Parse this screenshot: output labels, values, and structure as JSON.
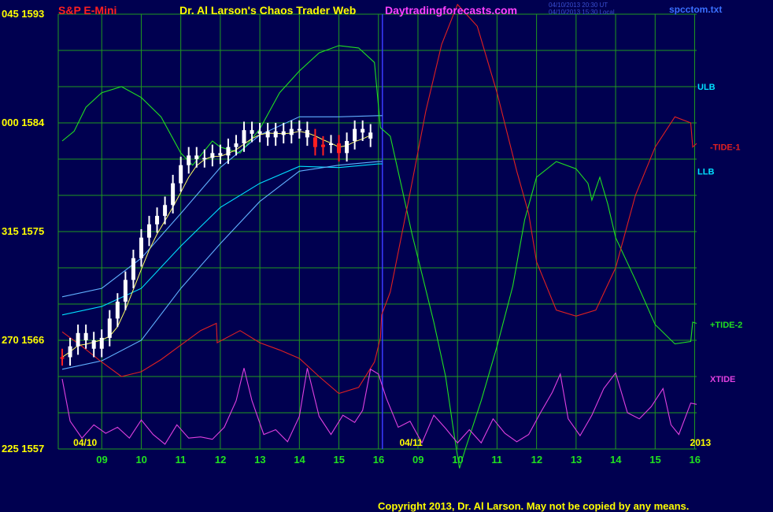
{
  "header": {
    "left_label": "S&P E-Mini",
    "title": "Dr. Al Larson's Chaos Trader Web",
    "site": "Daytradingforecasts.com",
    "file": "spcctom.txt",
    "timestamp_1": "04/10/2013 20:30 UT",
    "timestamp_2": "04/10/2013 15:30 Local"
  },
  "copyright": "Copyright 2013, Dr. Al Larson. May not be copied by any means.",
  "colors": {
    "background": "#000050",
    "grid": "#1f9a1f",
    "divider": "#3a3aff",
    "price_up": "#ffffff",
    "price_low": "#ffffaa",
    "price_down": "#ff2020",
    "ulb": "#00e0ff",
    "llb": "#00e0ff",
    "tide1": "#e02020",
    "tide2": "#20e020",
    "xtide": "#e040e0",
    "band": "#60b0ff",
    "ma": "#ffff60"
  },
  "chart_data": {
    "type": "line",
    "y_left_labels": [
      {
        "value": 1593,
        "text": "1593",
        "code": "045"
      },
      {
        "value": 1584,
        "text": "1584",
        "code": "000"
      },
      {
        "value": 1575,
        "text": "1575",
        "code": "315"
      },
      {
        "value": 1566,
        "text": "1566",
        "code": "270"
      },
      {
        "value": 1557,
        "text": "1557",
        "code": "225"
      }
    ],
    "ylim": [
      1557,
      1593
    ],
    "x_hour_labels": [
      {
        "t": 9,
        "text": "09"
      },
      {
        "t": 10,
        "text": "10"
      },
      {
        "t": 11,
        "text": "11"
      },
      {
        "t": 12,
        "text": "12"
      },
      {
        "t": 13,
        "text": "13"
      },
      {
        "t": 14,
        "text": "14"
      },
      {
        "t": 15,
        "text": "15"
      },
      {
        "t": 16,
        "text": "16"
      },
      {
        "t": 17,
        "text": "09"
      },
      {
        "t": 18,
        "text": "10"
      },
      {
        "t": 19,
        "text": "11"
      },
      {
        "t": 20,
        "text": "12"
      },
      {
        "t": 21,
        "text": "13"
      },
      {
        "t": 22,
        "text": "14"
      },
      {
        "t": 23,
        "text": "15"
      },
      {
        "t": 24,
        "text": "16"
      }
    ],
    "xlim": [
      7.9,
      24.05
    ],
    "date_labels": [
      {
        "t": 8.6,
        "text": "04/10"
      },
      {
        "t": 16.85,
        "text": "04/11"
      },
      {
        "t": 24.2,
        "text": "2013"
      }
    ],
    "divider_t": 16.1,
    "right_labels": [
      {
        "name": "ULB",
        "text": "ULB",
        "value": 1587,
        "color": "#00e0ff"
      },
      {
        "name": "TIDE-1",
        "text": "-TIDE-1",
        "value": 1582,
        "color": "#e02020"
      },
      {
        "name": "LLB",
        "text": "LLB",
        "value": 1580,
        "color": "#00e0ff"
      },
      {
        "name": "TIDE-2",
        "text": "+TIDE-2",
        "value": 1567.3,
        "color": "#20e020"
      },
      {
        "name": "XTIDE",
        "text": "XTIDE",
        "value": 1562.8,
        "color": "#e040e0"
      }
    ],
    "price_bars": [
      {
        "t": 8.0,
        "close": 1564.6,
        "color": "down"
      },
      {
        "t": 8.2,
        "close": 1565.5
      },
      {
        "t": 8.4,
        "close": 1566.6
      },
      {
        "t": 8.6,
        "close": 1566.0
      },
      {
        "t": 8.8,
        "close": 1565.3
      },
      {
        "t": 9.0,
        "close": 1566.2
      },
      {
        "t": 9.2,
        "close": 1567.8
      },
      {
        "t": 9.4,
        "close": 1569.2
      },
      {
        "t": 9.6,
        "close": 1571.0
      },
      {
        "t": 9.8,
        "close": 1572.8
      },
      {
        "t": 10.0,
        "close": 1574.5
      },
      {
        "t": 10.2,
        "close": 1575.6
      },
      {
        "t": 10.4,
        "close": 1576.3
      },
      {
        "t": 10.6,
        "close": 1577.2
      },
      {
        "t": 10.8,
        "close": 1579.0
      },
      {
        "t": 11.0,
        "close": 1580.5
      },
      {
        "t": 11.2,
        "close": 1581.3
      },
      {
        "t": 11.4,
        "close": 1581.0
      },
      {
        "t": 11.6,
        "close": 1581.1
      },
      {
        "t": 11.8,
        "close": 1581.5
      },
      {
        "t": 12.0,
        "close": 1581.3
      },
      {
        "t": 12.2,
        "close": 1582.0
      },
      {
        "t": 12.4,
        "close": 1582.3
      },
      {
        "t": 12.6,
        "close": 1583.4
      },
      {
        "t": 12.8,
        "close": 1583.1
      },
      {
        "t": 13.0,
        "close": 1583.3
      },
      {
        "t": 13.2,
        "close": 1582.8
      },
      {
        "t": 13.4,
        "close": 1583.3
      },
      {
        "t": 13.6,
        "close": 1583.0
      },
      {
        "t": 13.8,
        "close": 1583.5
      },
      {
        "t": 14.0,
        "close": 1583.4
      },
      {
        "t": 14.2,
        "close": 1582.8
      },
      {
        "t": 14.4,
        "close": 1582.0,
        "color": "down"
      },
      {
        "t": 14.6,
        "close": 1582.2,
        "color": "down"
      },
      {
        "t": 14.8,
        "close": 1582.3
      },
      {
        "t": 15.0,
        "close": 1581.5,
        "color": "down"
      },
      {
        "t": 15.2,
        "close": 1582.5
      },
      {
        "t": 15.4,
        "close": 1583.5
      },
      {
        "t": 15.6,
        "close": 1583.2
      },
      {
        "t": 15.8,
        "close": 1582.7
      }
    ],
    "series": [
      {
        "name": "ULB",
        "color": "#00e0ff",
        "points": [
          [
            8.0,
            1568.1
          ],
          [
            9.0,
            1568.8
          ],
          [
            10.0,
            1570.3
          ],
          [
            11.0,
            1573.8
          ],
          [
            12.0,
            1577.0
          ],
          [
            13.0,
            1579.0
          ],
          [
            14.0,
            1580.4
          ],
          [
            15.0,
            1580.3
          ],
          [
            16.0,
            1580.6
          ],
          [
            16.1,
            1580.6
          ]
        ]
      },
      {
        "name": "Band-upper",
        "color": "#60b0ff",
        "points": [
          [
            8.0,
            1569.6
          ],
          [
            9.0,
            1570.3
          ],
          [
            10.0,
            1572.8
          ],
          [
            11.0,
            1576.5
          ],
          [
            12.0,
            1580.3
          ],
          [
            13.0,
            1583.0
          ],
          [
            14.0,
            1584.5
          ],
          [
            15.0,
            1584.5
          ],
          [
            16.0,
            1584.6
          ],
          [
            16.1,
            1584.6
          ]
        ]
      },
      {
        "name": "Band-lower",
        "color": "#60b0ff",
        "points": [
          [
            8.0,
            1563.6
          ],
          [
            9.0,
            1564.3
          ],
          [
            10.0,
            1566.0
          ],
          [
            11.0,
            1570.3
          ],
          [
            12.0,
            1574.0
          ],
          [
            13.0,
            1577.5
          ],
          [
            14.0,
            1580.0
          ],
          [
            15.0,
            1580.5
          ],
          [
            16.0,
            1580.8
          ],
          [
            16.1,
            1580.8
          ]
        ]
      },
      {
        "name": "TIDE-2",
        "color": "#20e020",
        "points": [
          [
            8.0,
            1582.5
          ],
          [
            8.3,
            1583.3
          ],
          [
            8.6,
            1585.3
          ],
          [
            9.0,
            1586.5
          ],
          [
            9.5,
            1587.0
          ],
          [
            10.0,
            1586.1
          ],
          [
            10.5,
            1584.5
          ],
          [
            11.0,
            1581.5
          ],
          [
            11.3,
            1580.5
          ],
          [
            11.8,
            1582.5
          ],
          [
            12.0,
            1582.0
          ],
          [
            12.5,
            1581.5
          ],
          [
            13.0,
            1583.5
          ],
          [
            13.5,
            1586.5
          ],
          [
            14.0,
            1588.3
          ],
          [
            14.5,
            1589.8
          ],
          [
            15.0,
            1590.4
          ],
          [
            15.5,
            1590.2
          ],
          [
            15.9,
            1589.0
          ],
          [
            16.05,
            1583.6
          ],
          [
            16.3,
            1582.9
          ],
          [
            16.6,
            1578.5
          ],
          [
            16.85,
            1574.8
          ],
          [
            17.1,
            1571.5
          ],
          [
            17.4,
            1567.5
          ],
          [
            17.7,
            1563.0
          ],
          [
            17.9,
            1558.5
          ],
          [
            18.05,
            1555.4
          ],
          [
            18.2,
            1557.0
          ],
          [
            18.6,
            1561.0
          ],
          [
            19.0,
            1565.5
          ],
          [
            19.4,
            1570.5
          ],
          [
            19.7,
            1576.0
          ],
          [
            20.0,
            1579.5
          ],
          [
            20.5,
            1580.8
          ],
          [
            21.0,
            1580.2
          ],
          [
            21.3,
            1579.0
          ],
          [
            21.4,
            1577.6
          ],
          [
            21.6,
            1579.5
          ],
          [
            21.8,
            1577.3
          ],
          [
            22.0,
            1574.5
          ],
          [
            22.5,
            1571.0
          ],
          [
            23.0,
            1567.3
          ],
          [
            23.5,
            1565.7
          ],
          [
            23.9,
            1565.9
          ],
          [
            23.95,
            1567.5
          ],
          [
            24.05,
            1567.4
          ]
        ]
      },
      {
        "name": "TIDE-1",
        "color": "#e02020",
        "points": [
          [
            8.0,
            1566.7
          ],
          [
            8.5,
            1565.5
          ],
          [
            9.0,
            1564.2
          ],
          [
            9.5,
            1563.0
          ],
          [
            10.0,
            1563.4
          ],
          [
            10.5,
            1564.4
          ],
          [
            11.0,
            1565.6
          ],
          [
            11.5,
            1566.8
          ],
          [
            11.9,
            1567.4
          ],
          [
            11.92,
            1565.8
          ],
          [
            12.5,
            1566.8
          ],
          [
            13.0,
            1565.8
          ],
          [
            13.5,
            1565.2
          ],
          [
            14.0,
            1564.5
          ],
          [
            14.5,
            1563.0
          ],
          [
            15.0,
            1561.6
          ],
          [
            15.5,
            1562.1
          ],
          [
            15.9,
            1564.2
          ],
          [
            16.05,
            1566.2
          ],
          [
            16.08,
            1568.1
          ],
          [
            16.3,
            1570.0
          ],
          [
            16.8,
            1578.2
          ],
          [
            17.2,
            1585.0
          ],
          [
            17.6,
            1590.5
          ],
          [
            18.0,
            1593.8
          ],
          [
            18.5,
            1592.0
          ],
          [
            19.0,
            1586.5
          ],
          [
            19.5,
            1580.0
          ],
          [
            19.8,
            1576.5
          ],
          [
            20.0,
            1572.5
          ],
          [
            20.5,
            1568.5
          ],
          [
            21.0,
            1568.0
          ],
          [
            21.5,
            1568.5
          ],
          [
            22.0,
            1572.0
          ],
          [
            22.5,
            1578.0
          ],
          [
            23.0,
            1582.0
          ],
          [
            23.5,
            1584.5
          ],
          [
            23.9,
            1584.0
          ],
          [
            23.95,
            1582.0
          ],
          [
            24.05,
            1582.3
          ]
        ]
      },
      {
        "name": "XTIDE",
        "color": "#e040e0",
        "points": [
          [
            8.0,
            1562.8
          ],
          [
            8.2,
            1559.3
          ],
          [
            8.5,
            1557.9
          ],
          [
            8.8,
            1559.0
          ],
          [
            9.1,
            1558.3
          ],
          [
            9.4,
            1558.8
          ],
          [
            9.7,
            1557.9
          ],
          [
            10.0,
            1559.4
          ],
          [
            10.3,
            1558.2
          ],
          [
            10.6,
            1557.4
          ],
          [
            10.9,
            1559.0
          ],
          [
            11.2,
            1557.9
          ],
          [
            11.5,
            1558.0
          ],
          [
            11.8,
            1557.8
          ],
          [
            12.1,
            1558.8
          ],
          [
            12.4,
            1561.0
          ],
          [
            12.6,
            1563.7
          ],
          [
            12.8,
            1561.0
          ],
          [
            13.1,
            1558.2
          ],
          [
            13.4,
            1558.6
          ],
          [
            13.7,
            1557.6
          ],
          [
            14.0,
            1559.7
          ],
          [
            14.2,
            1563.7
          ],
          [
            14.5,
            1559.7
          ],
          [
            14.8,
            1558.2
          ],
          [
            15.1,
            1559.8
          ],
          [
            15.4,
            1559.2
          ],
          [
            15.6,
            1560.2
          ],
          [
            15.8,
            1563.6
          ],
          [
            16.0,
            1563.2
          ],
          [
            16.2,
            1561.2
          ],
          [
            16.5,
            1558.8
          ],
          [
            16.8,
            1559.3
          ],
          [
            17.1,
            1557.5
          ],
          [
            17.4,
            1559.8
          ],
          [
            17.7,
            1558.7
          ],
          [
            18.0,
            1557.5
          ],
          [
            18.3,
            1558.6
          ],
          [
            18.6,
            1557.5
          ],
          [
            18.9,
            1559.5
          ],
          [
            19.2,
            1558.3
          ],
          [
            19.5,
            1557.6
          ],
          [
            19.8,
            1558.2
          ],
          [
            20.1,
            1560.0
          ],
          [
            20.4,
            1561.7
          ],
          [
            20.6,
            1563.2
          ],
          [
            20.8,
            1559.5
          ],
          [
            21.1,
            1558.1
          ],
          [
            21.4,
            1559.8
          ],
          [
            21.7,
            1562.0
          ],
          [
            22.0,
            1563.3
          ],
          [
            22.3,
            1560.0
          ],
          [
            22.6,
            1559.5
          ],
          [
            22.9,
            1560.5
          ],
          [
            23.2,
            1562.0
          ],
          [
            23.4,
            1559.0
          ],
          [
            23.6,
            1558.2
          ],
          [
            23.9,
            1560.8
          ],
          [
            24.05,
            1560.7
          ]
        ]
      }
    ]
  }
}
